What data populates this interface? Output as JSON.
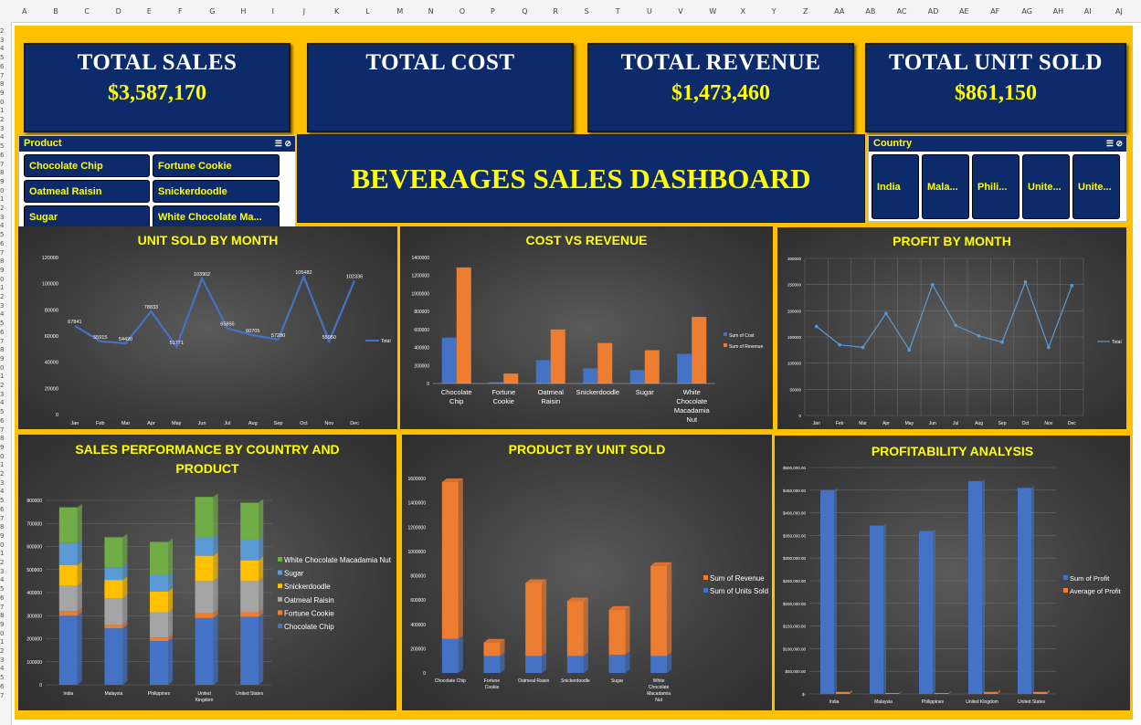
{
  "spreadsheet": {
    "columns": [
      "A",
      "B",
      "C",
      "D",
      "E",
      "F",
      "G",
      "H",
      "I",
      "J",
      "K",
      "L",
      "M",
      "N",
      "O",
      "P",
      "Q",
      "R",
      "S",
      "T",
      "U",
      "V",
      "W",
      "X",
      "Y",
      "Z",
      "AA",
      "AB",
      "AC",
      "AD",
      "AE",
      "AF",
      "AG",
      "AH",
      "AI",
      "AJ"
    ],
    "rows": [
      "2",
      "3",
      "4",
      "5",
      "6",
      "7",
      "8",
      "9",
      "0",
      "1",
      "2",
      "3",
      "4",
      "5",
      "6",
      "7",
      "8",
      "9",
      "0",
      "1",
      "2",
      "3",
      "4",
      "5",
      "6",
      "7",
      "8",
      "9",
      "0",
      "1",
      "2",
      "3",
      "4",
      "5",
      "6",
      "7",
      "8",
      "9",
      "0",
      "1",
      "2",
      "3",
      "4",
      "5",
      "6",
      "7",
      "8",
      "9",
      "0",
      "1",
      "2",
      "3",
      "4",
      "5",
      "6",
      "7",
      "8",
      "9",
      "0",
      "1",
      "2",
      "3",
      "4",
      "5",
      "6",
      "7",
      "8",
      "9",
      "0",
      "1",
      "2",
      "3",
      "4",
      "5",
      "6",
      "7"
    ]
  },
  "kpis": [
    {
      "label": "TOTAL SALES",
      "value": "$3,587,170"
    },
    {
      "label": "TOTAL COST",
      "value": ""
    },
    {
      "label": "TOTAL REVENUE",
      "value": "$1,473,460"
    },
    {
      "label": "TOTAL UNIT SOLD",
      "value": "$861,150"
    }
  ],
  "dashboard_title": "BEVERAGES SALES DASHBOARD",
  "product_slicer": {
    "header": "Product",
    "items": [
      "Chocolate Chip",
      "Fortune Cookie",
      "Oatmeal Raisin",
      "Snickerdoodle",
      "Sugar",
      "White Chocolate Ma..."
    ]
  },
  "country_slicer": {
    "header": "Country",
    "items": [
      "India",
      "Mala...",
      "Phili...",
      "Unite...",
      "Unite..."
    ]
  },
  "panel_titles": {
    "unit_sold": "UNIT SOLD BY MONTH",
    "cost_revenue": "COST VS REVENUE",
    "profit_month": "PROFIT BY MONTH",
    "sales_country_line1": "SALES PERFORMANCE BY COUNTRY AND",
    "sales_country_line2": "PRODUCT",
    "product_units": "PRODUCT BY UNIT SOLD",
    "profitability": "PROFITABILITY ANALYSIS"
  },
  "colors": {
    "blue": "#4472c4",
    "orange": "#ed7d31",
    "gray": "#a5a5a5",
    "gold": "#ffc000",
    "lightblue": "#5b9bd5",
    "green": "#70ad47",
    "navy": "#0d2a6b",
    "yellow": "#ffff00"
  },
  "chart_data": [
    {
      "id": "unit_sold_by_month",
      "type": "line",
      "categories": [
        "Jan",
        "Feb",
        "Mar",
        "Apr",
        "May",
        "Jun",
        "Jul",
        "Aug",
        "Sep",
        "Oct",
        "Nov",
        "Dec"
      ],
      "series": [
        {
          "name": "Total",
          "values": [
            67841,
            55915,
            54420,
            78833,
            51771,
            103902,
            65855,
            60705,
            57280,
            105482,
            55950,
            102336
          ]
        }
      ],
      "data_labels": [
        "67841",
        "55915",
        "54420",
        "78833",
        "51771",
        "103902",
        "65855",
        "60705",
        "57280",
        "105482",
        "55950",
        "102336"
      ],
      "yticks": [
        "0",
        "20000",
        "40000",
        "60000",
        "80000",
        "100000",
        "120000"
      ],
      "ylim": [
        0,
        120000
      ]
    },
    {
      "id": "cost_vs_revenue",
      "type": "bar",
      "categories": [
        [
          "Chocolate",
          "Chip"
        ],
        [
          "Fortune",
          "Cookie"
        ],
        [
          "Oatmeal",
          "Raisin"
        ],
        [
          "Snickerdoodle"
        ],
        [
          "Sugar"
        ],
        [
          "White",
          "Chocolate",
          "Macadamia",
          "Nut"
        ]
      ],
      "series": [
        {
          "name": "Sum of Cost",
          "values": [
            510000,
            15000,
            260000,
            170000,
            150000,
            330000
          ]
        },
        {
          "name": "Sum of Revenue",
          "values": [
            1290000,
            110000,
            600000,
            450000,
            370000,
            740000
          ]
        }
      ],
      "yticks": [
        "0",
        "200000",
        "400000",
        "600000",
        "800000",
        "1000000",
        "1200000",
        "1400000"
      ],
      "ylim": [
        0,
        1400000
      ]
    },
    {
      "id": "profit_by_month",
      "type": "line",
      "categories": [
        "Jan",
        "Feb",
        "Mar",
        "Apr",
        "May",
        "Jun",
        "Jul",
        "Aug",
        "Sep",
        "Oct",
        "Nov",
        "Dec"
      ],
      "series": [
        {
          "name": "Total",
          "values": [
            170000,
            135000,
            130000,
            195000,
            125000,
            250000,
            172000,
            152000,
            140000,
            255000,
            130000,
            248000
          ]
        }
      ],
      "yticks": [
        "0",
        "50000",
        "100000",
        "150000",
        "200000",
        "250000",
        "300000"
      ],
      "ylim": [
        0,
        300000
      ]
    },
    {
      "id": "sales_by_country_product",
      "type": "bar",
      "stacked": true,
      "categories": [
        [
          "India"
        ],
        [
          "Malaysia"
        ],
        [
          "Philippines"
        ],
        [
          "United",
          "Kingdom"
        ],
        [
          "United States"
        ]
      ],
      "series": [
        {
          "name": "Chocolate Chip",
          "values": [
            300000,
            245000,
            190000,
            290000,
            295000
          ]
        },
        {
          "name": "Fortune Cookie",
          "values": [
            20000,
            15000,
            15000,
            20000,
            20000
          ]
        },
        {
          "name": "Oatmeal Raisin",
          "values": [
            110000,
            115000,
            110000,
            140000,
            135000
          ]
        },
        {
          "name": "Snickerdoodle",
          "values": [
            90000,
            80000,
            90000,
            110000,
            90000
          ]
        },
        {
          "name": "Sugar",
          "values": [
            95000,
            55000,
            70000,
            80000,
            90000
          ]
        },
        {
          "name": "White Chocolate Macadamia Nut",
          "values": [
            155000,
            130000,
            145000,
            175000,
            160000
          ]
        }
      ],
      "legend": [
        "White Chocolate Macadamia Nut",
        "Sugar",
        "Snickerdoodle",
        "Oatmeal Raisin",
        "Fortune Cookie",
        "Chocolate Chip"
      ],
      "yticks": [
        "0",
        "100000",
        "200000",
        "300000",
        "400000",
        "500000",
        "600000",
        "700000",
        "800000"
      ],
      "ylim": [
        0,
        800000
      ]
    },
    {
      "id": "product_by_unit_sold",
      "type": "bar",
      "stacked": true,
      "categories": [
        [
          "Chocolate Chip"
        ],
        [
          "Fortune",
          "Cookie"
        ],
        [
          "Oatmeal Raisin"
        ],
        [
          "Snickerdoodle"
        ],
        [
          "Sugar"
        ],
        [
          "White",
          "Chocolate",
          "Macadamia",
          "Nut"
        ]
      ],
      "series": [
        {
          "name": "Sum of Units Sold",
          "values": [
            280000,
            140000,
            140000,
            140000,
            150000,
            140000
          ]
        },
        {
          "name": "Sum of Revenue",
          "values": [
            1290000,
            110000,
            600000,
            450000,
            370000,
            740000
          ]
        }
      ],
      "legend": [
        "Sum of Revenue",
        "Sum of Units Sold"
      ],
      "yticks": [
        "0",
        "200000",
        "400000",
        "600000",
        "800000",
        "1000000",
        "1200000",
        "1400000",
        "1600000"
      ],
      "ylim": [
        0,
        1600000
      ]
    },
    {
      "id": "profitability_analysis",
      "type": "bar",
      "categories": [
        [
          "India"
        ],
        [
          "Malaysia"
        ],
        [
          "Philippines"
        ],
        [
          "United Kingdom"
        ],
        [
          "United States"
        ]
      ],
      "series": [
        {
          "name": "Sum of Profit",
          "values": [
            450000,
            372000,
            360000,
            470000,
            455000
          ]
        },
        {
          "name": "Average of Profit",
          "values": [
            4500,
            1500,
            1500,
            4500,
            4500
          ]
        }
      ],
      "yticks": [
        "$-",
        "$50,000.00",
        "$100,000.00",
        "$150,000.00",
        "$200,000.00",
        "$250,000.00",
        "$300,000.00",
        "$350,000.00",
        "$400,000.00",
        "$450,000.00",
        "$500,000.00"
      ],
      "ylim": [
        0,
        500000
      ]
    }
  ]
}
